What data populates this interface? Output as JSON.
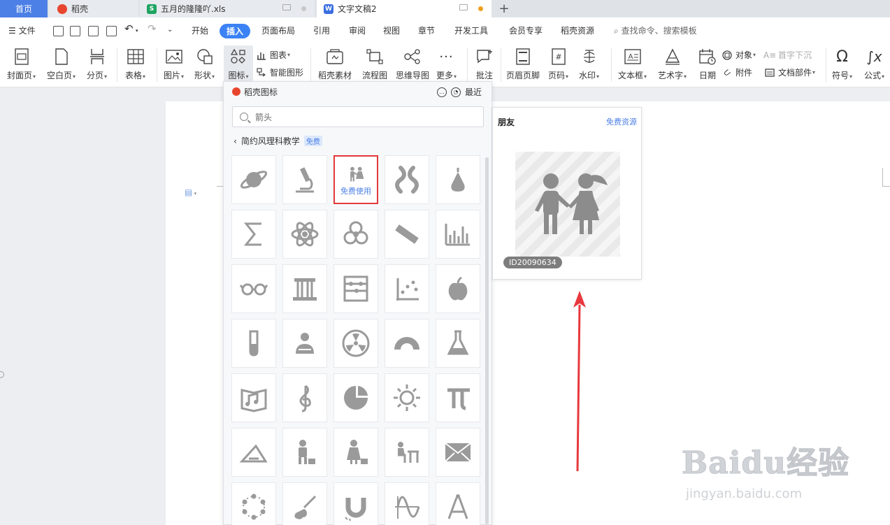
{
  "tabs": {
    "home": "首页",
    "daoke": "稻壳",
    "xls": "五月的隆隆吖.xls",
    "doc": "文字文稿2",
    "xls_icon": "S",
    "doc_icon": "W"
  },
  "menu": {
    "file": "文件",
    "items": [
      "开始",
      "插入",
      "页面布局",
      "引用",
      "审阅",
      "视图",
      "章节",
      "开发工具",
      "会员专享",
      "稻壳资源"
    ],
    "active": "插入",
    "search": "查找命令、搜索模板"
  },
  "ribbon": {
    "cover": "封面页",
    "blank": "空白页",
    "pagebreak": "分页",
    "table": "表格",
    "picture": "图片",
    "shape": "形状",
    "icon": "图标",
    "chart": "图表",
    "smartart": "智能图形",
    "material": "稻壳素材",
    "flowchart": "流程图",
    "mindmap": "思维导图",
    "more": "更多",
    "comment": "批注",
    "header_footer": "页眉页脚",
    "page_number": "页码",
    "watermark": "水印",
    "textbox": "文本框",
    "wordart": "艺术字",
    "date": "日期",
    "object": "对象",
    "attachment": "附件",
    "dropcap": "首字下沉",
    "doc_parts": "文档部件",
    "symbol": "符号",
    "formula": "公式"
  },
  "panel": {
    "title": "稻壳图标",
    "recent": "最近",
    "search_value": "箭头",
    "breadcrumb": "简约风理科教学",
    "free_badge": "免费",
    "use_label": "免费使用",
    "icons": [
      "planet-icon",
      "microscope-icon",
      "friends-icon",
      "chromosome-icon",
      "pear-icon",
      "sigma-icon",
      "atom-icon",
      "biohazard-icon",
      "ruler-icon",
      "bar-chart-icon",
      "glasses-icon",
      "column-icon",
      "abacus-icon",
      "scatter-plot-icon",
      "apple-icon",
      "test-tube-icon",
      "reader-icon",
      "radiation-icon",
      "protractor-icon",
      "flask-icon",
      "music-book-icon",
      "treble-clef-icon",
      "pie-chart-icon",
      "sun-icon",
      "pi-icon",
      "triangle-ruler-icon",
      "male-teacher-icon",
      "female-teacher-icon",
      "student-desk-icon",
      "envelope-icon",
      "molecule-ring-icon",
      "guitar-icon",
      "magnet-icon",
      "sine-wave-icon",
      "compass-icon"
    ]
  },
  "preview": {
    "title": "朋友",
    "link": "免费资源",
    "id": "ID20090634"
  },
  "colors": {
    "accent": "#4d80e6",
    "highlight_border": "#e23a3a",
    "arrow": "#e8383d",
    "icon_gray": "#9a9a9a"
  },
  "watermark": {
    "main": "Baidu经验",
    "sub": "jingyan.baidu.com"
  }
}
